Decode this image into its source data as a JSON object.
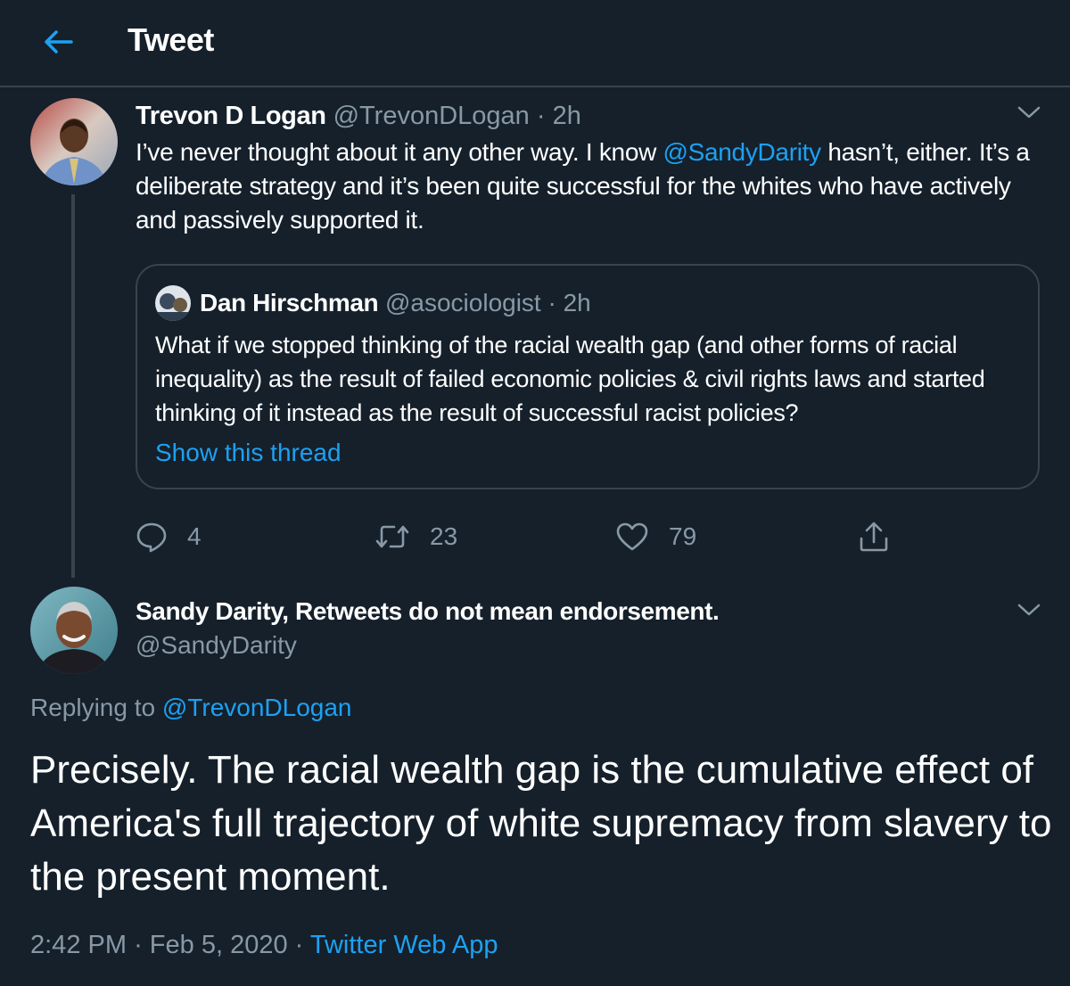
{
  "header": {
    "title": "Tweet"
  },
  "tweet1": {
    "name": "Trevon D Logan",
    "handle": "@TrevonDLogan",
    "time": "2h",
    "text_before": "I’ve never thought about it any other way. I know ",
    "mention": "@SandyDarity",
    "text_after": " hasn’t, either. It’s a deliberate strategy and it’s been quite successful for the whites who have actively and passively supported it.",
    "quote": {
      "name": "Dan Hirschman",
      "handle": "@asociologist",
      "time": "2h",
      "text": "What if we stopped thinking of the racial wealth gap (and other forms of racial inequality) as the result of failed economic policies & civil rights laws and started thinking of it instead as the result of successful racist policies?",
      "show_thread": "Show this thread"
    },
    "actions": {
      "replies": "4",
      "retweets": "23",
      "likes": "79"
    }
  },
  "tweet2": {
    "name": "Sandy Darity, Retweets do not mean endorsement.",
    "handle": "@SandyDarity",
    "replying_label": "Replying to",
    "replying_to": "@TrevonDLogan",
    "text": "Precisely. The racial wealth gap is the cumulative effect of America's full trajectory of white supremacy from slavery to the present moment.",
    "time": "2:42 PM",
    "date": "Feb 5, 2020",
    "source": "Twitter Web App"
  },
  "separator": "·",
  "colors": {
    "background": "#15202b",
    "accent": "#1da1f2",
    "muted": "#8899a6",
    "border": "#38444d"
  },
  "icons": [
    "back-arrow-icon",
    "chevron-down-icon",
    "reply-icon",
    "retweet-icon",
    "like-icon",
    "share-icon"
  ]
}
